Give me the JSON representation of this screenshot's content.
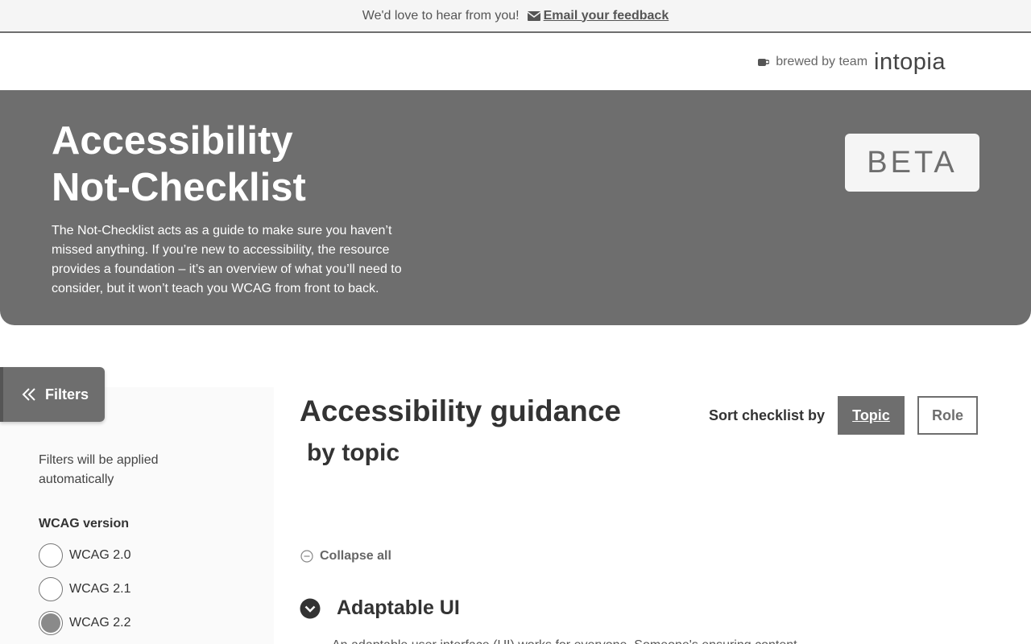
{
  "feedback": {
    "message": "We'd love to hear from you!",
    "link_label": "Email your feedback"
  },
  "brand": {
    "tagline": "brewed by team",
    "logo_text": "intopia"
  },
  "hero": {
    "title_line1": "Accessibility",
    "title_line2": "Not-Checklist",
    "description": "The Not-Checklist acts as a guide to make sure you haven’t missed anything. If you’re new to accessibility, the resource provides a foundation – it’s an overview of what you’ll need to consider, but it won’t teach you WCAG from front to back.",
    "badge": "BETA"
  },
  "sidebar": {
    "filters_label": "Filters",
    "note": "Filters will be applied automatically",
    "wcag_group_title": "WCAG version",
    "wcag_options": [
      {
        "label": "WCAG 2.0",
        "checked": false
      },
      {
        "label": "WCAG 2.1",
        "checked": false
      },
      {
        "label": "WCAG 2.2",
        "checked": true
      }
    ]
  },
  "main": {
    "title": "Accessibility guidance",
    "subtitle": "by topic",
    "sort_label": "Sort checklist by",
    "sort_options": [
      "Topic",
      "Role"
    ],
    "sort_selected": "Topic",
    "collapse_label": "Collapse all",
    "section_title": "Adaptable UI",
    "section_desc": "An adaptable user interface (UI) works for everyone. Someone's ensuring content"
  },
  "colors": {
    "primary_gray": "#6e6e6e",
    "banner_bg": "#f5f5f5",
    "text_dark": "#333333"
  },
  "icons": {
    "feedback": "mail-icon",
    "brand": "coffee-cup-icon",
    "filters": "double-chevron-left-icon",
    "collapse": "minus-circle-icon",
    "section_toggle": "chevron-down-circle-icon"
  }
}
